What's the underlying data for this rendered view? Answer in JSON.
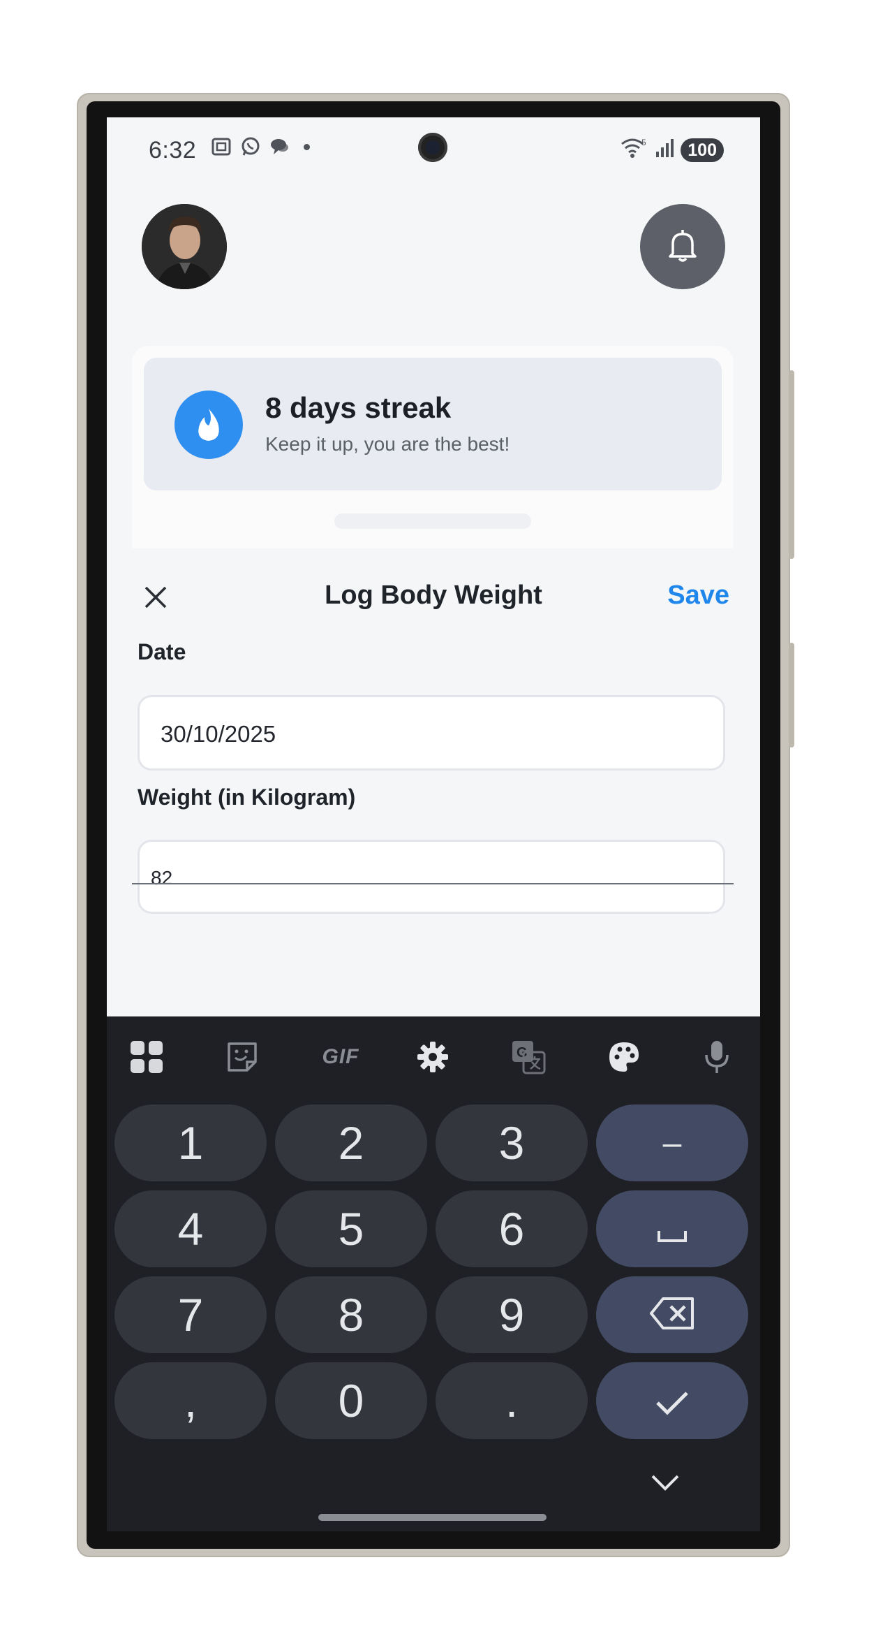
{
  "status": {
    "time": "6:32",
    "battery": "100",
    "wifi_badge": "5"
  },
  "header": {
    "avatar_alt": "profile avatar",
    "bell_icon": "bell-icon"
  },
  "streak": {
    "title": "8 days streak",
    "subtitle": "Keep it up, you are the best!",
    "icon": "flame-icon",
    "accent": "#2f8ff0"
  },
  "sheet": {
    "title": "Log Body Weight",
    "save_label": "Save",
    "close_icon": "close-icon",
    "date_label": "Date",
    "date_value": "30/10/2025",
    "weight_label": "Weight (in Kilogram)",
    "weight_value": "82",
    "accent": "#1f86ec"
  },
  "keyboard": {
    "toolbar": [
      "apps-grid-icon",
      "sticker-icon",
      "GIF",
      "settings-icon",
      "translate-icon",
      "palette-icon",
      "mic-icon"
    ],
    "gif_label": "GIF",
    "keys": {
      "k1": "1",
      "k2": "2",
      "k3": "3",
      "minus": "–",
      "k4": "4",
      "k5": "5",
      "k6": "6",
      "space": "␣",
      "k7": "7",
      "k8": "8",
      "k9": "9",
      "comma": ",",
      "k0": "0",
      "period": "."
    }
  }
}
